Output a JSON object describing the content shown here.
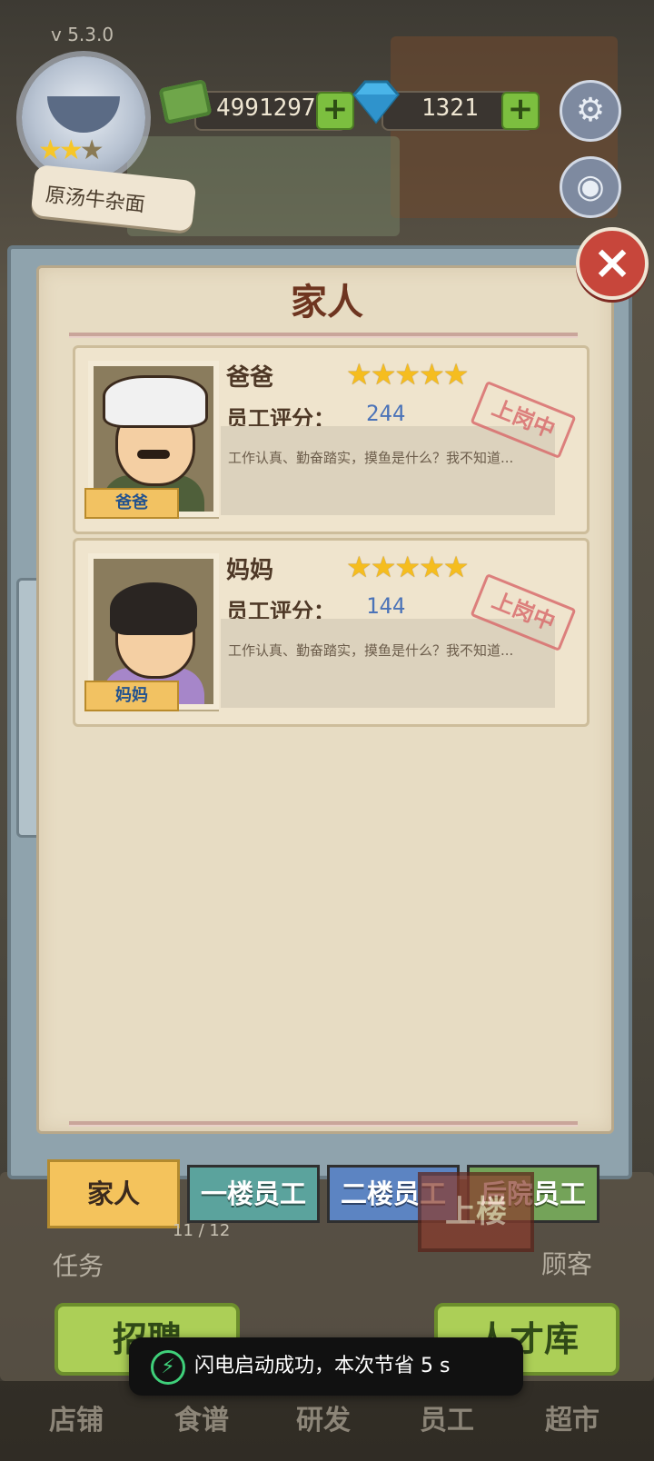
{
  "hud": {
    "version": "v  5.3.0",
    "shop_name": "原汤牛杂面",
    "cash": "4991297",
    "gems": "1321",
    "plus": "+"
  },
  "dialog": {
    "title": "家人",
    "close": "×",
    "employees": [
      {
        "name": "爸爸",
        "ribbon": "爸爸",
        "stars": "★★★★★",
        "score_label": "员工评分：",
        "score": "244",
        "description": "工作认真、勤奋踏实，摸鱼是什么？我不知道...",
        "status": "上岗中"
      },
      {
        "name": "妈妈",
        "ribbon": "妈妈",
        "stars": "★★★★★",
        "score_label": "员工评分：",
        "score": "144",
        "description": "工作认真、勤奋踏实，摸鱼是什么？我不知道...",
        "status": "上岗中"
      }
    ],
    "tabs": [
      "家人",
      "一楼员工",
      "二楼员工",
      "后院员工"
    ]
  },
  "background": {
    "task_label": "任务",
    "customer_label": "顾客",
    "progress": "11 / 12",
    "upstairs": "上楼",
    "recruit": "招聘",
    "talent_pool": "人才库"
  },
  "toast": {
    "message": "闪电启动成功，本次节省 5 s"
  },
  "bottom_nav": [
    "店铺",
    "食谱",
    "研发",
    "员工",
    "超市"
  ]
}
